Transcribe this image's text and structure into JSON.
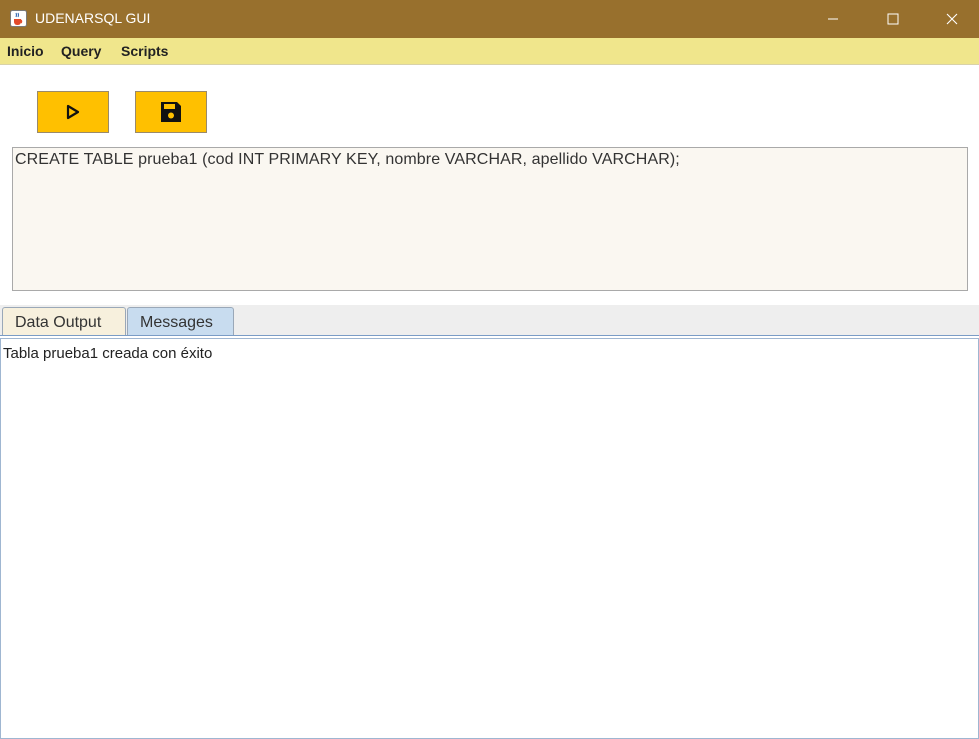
{
  "window": {
    "title": "UDENARSQL GUI",
    "icon": "java-coffee-cup-icon",
    "controls": [
      "minimize-icon",
      "maximize-icon",
      "close-icon"
    ],
    "titlebar_color": "#98702d"
  },
  "menu": {
    "items": [
      "Inicio",
      "Query",
      "Scripts"
    ],
    "background": "#f0e68c"
  },
  "toolbar": {
    "buttons": [
      {
        "icon": "play-icon",
        "label": ""
      },
      {
        "icon": "save-icon",
        "label": ""
      }
    ],
    "button_color": "#ffc000"
  },
  "editor": {
    "query": "CREATE TABLE prueba1 (cod INT PRIMARY KEY, nombre VARCHAR, apellido VARCHAR);"
  },
  "tabs": {
    "items": [
      "Data Output",
      "Messages"
    ],
    "active": "Messages"
  },
  "messages": {
    "text": "Tabla prueba1 creada con éxito"
  }
}
